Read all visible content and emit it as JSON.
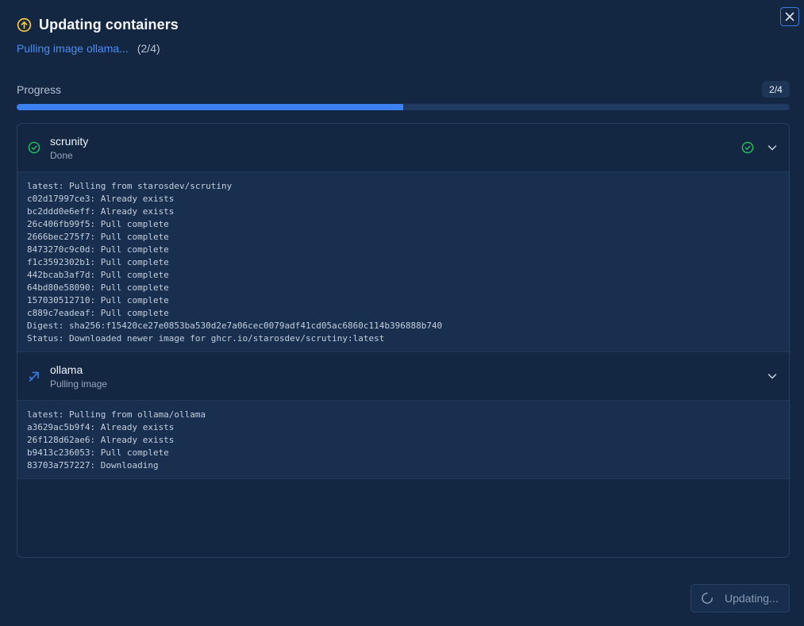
{
  "dialog": {
    "title": "Updating containers",
    "status_text": "Pulling image ollama...",
    "status_count": "(2/4)"
  },
  "progress": {
    "label": "Progress",
    "badge": "2/4",
    "completed": 2,
    "total": 4
  },
  "containers": [
    {
      "name": "scrunity",
      "status": "Done",
      "state": "done",
      "log": [
        "latest: Pulling from starosdev/scrutiny",
        "c02d17997ce3: Already exists",
        "bc2ddd0e6eff: Already exists",
        "26c406fb99f5: Pull complete",
        "2666bec275f7: Pull complete",
        "8473270c9c0d: Pull complete",
        "f1c3592302b1: Pull complete",
        "442bcab3af7d: Pull complete",
        "64bd80e58090: Pull complete",
        "157030512710: Pull complete",
        "c889c7eadeaf: Pull complete",
        "Digest: sha256:f15420ce27e0853ba530d2e7a06cec0079adf41cd05ac6860c114b396888b740",
        "Status: Downloaded newer image for ghcr.io/starosdev/scrutiny:latest"
      ]
    },
    {
      "name": "ollama",
      "status": "Pulling image",
      "state": "pulling",
      "log": [
        "latest: Pulling from ollama/ollama",
        "a3629ac5b9f4: Already exists",
        "26f128d62ae6: Already exists",
        "b9413c236053: Pull complete",
        "83703a757227: Downloading"
      ]
    }
  ],
  "footer": {
    "button_label": "Updating..."
  },
  "colors": {
    "background": "#132743",
    "accent": "#3b82f0",
    "success": "#22c55e",
    "warning": "#f5c542"
  },
  "icons": {
    "title": "arrow-up-circle-icon",
    "close": "close-icon",
    "done": "check-circle-icon",
    "pulling": "download-arrow-icon",
    "expand": "chevron-down-icon",
    "spinner": "spinner-icon"
  }
}
